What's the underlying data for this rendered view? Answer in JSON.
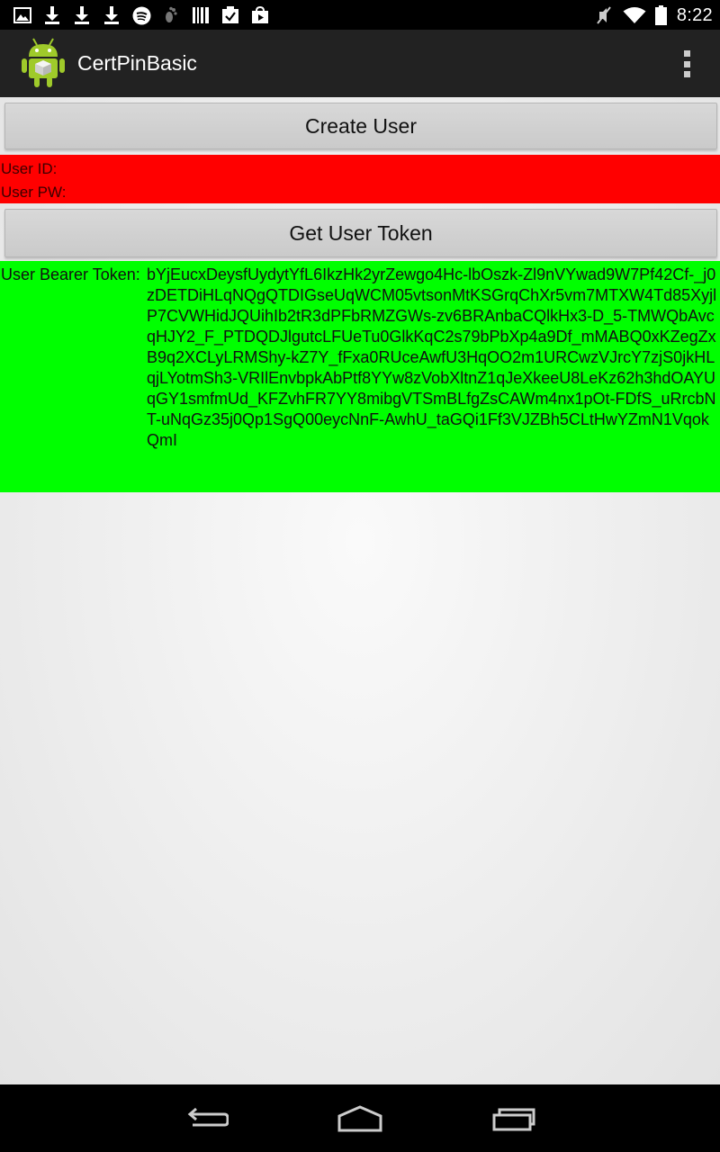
{
  "status_bar": {
    "time": "8:22",
    "left_icons": [
      "gallery-icon",
      "download-icon",
      "download-icon",
      "download-icon",
      "spotify-icon",
      "footprint-icon",
      "barcode-icon",
      "clipboard-check-icon",
      "play-store-icon"
    ],
    "right_icons": [
      "mute-icon",
      "wifi-icon",
      "battery-icon"
    ]
  },
  "action_bar": {
    "title": "CertPinBasic",
    "app_icon": "android-icon",
    "overflow_icon": "overflow-menu-icon"
  },
  "main": {
    "create_user_label": "Create User",
    "user_id_label": "User ID:",
    "user_pw_label": "User PW:",
    "get_token_label": "Get User Token",
    "token_label": "User Bearer Token:",
    "token_value": "bYjEucxDeysfUydytYfL6IkzHk2yrZewgo4Hc-lbOszk-Zl9nVYwad9W7Pf42Cf-_j0zDETDiHLqNQgQTDIGseUqWCM05vtsonMtKSGrqChXr5vm7MTXW4Td85XyjlP7CVWHidJQUihIb2tR3dPFbRMZGWs-zv6BRAnbaCQlkHx3-D_5-TMWQbAvcqHJY2_F_PTDQDJlgutcLFUeTu0GlkKqC2s79bPbXp4a9Df_mMABQ0xKZegZxB9q2XCLyLRMShy-kZ7Y_fFxa0RUceAwfU3HqOO2m1URCwzVJrcY7zjS0jkHLqjLYotmSh3-VRIlEnvbpkAbPtf8YYw8zVobXltnZ1qJeXkeeU8LeKz62h3hdOAYUqGY1smfmUd_KFZvhFR7YY8mibgVTSmBLfgZsCAWm4nx1pOt-FDfS_uRrcbNT-uNqGz35j0Qp1SgQ00eycNnF-AwhU_taGQi1Ff3VJZBh5CLtHwYZmN1VqokQmI"
  },
  "nav_bar": {
    "icons": [
      "back-icon",
      "home-icon",
      "recents-icon"
    ]
  },
  "colors": {
    "user_panel_bg": "#ff0000",
    "token_panel_bg": "#00ff00",
    "action_bar_bg": "#222222"
  }
}
